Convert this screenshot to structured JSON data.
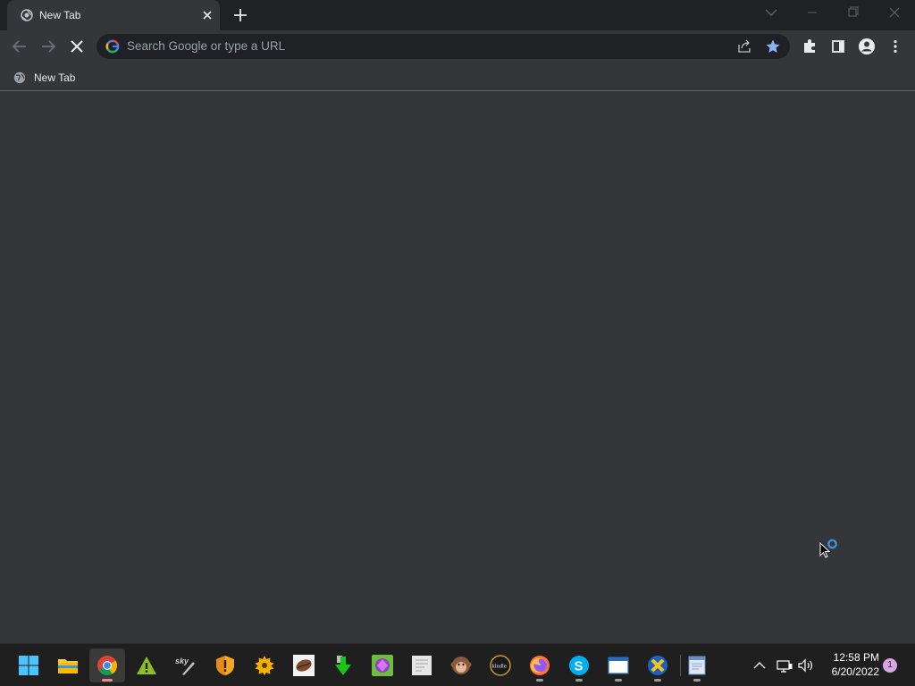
{
  "browser": {
    "tab": {
      "title": "New Tab"
    },
    "omnibox": {
      "placeholder": "Search Google or type a URL"
    },
    "bookmarks": [
      {
        "label": "New Tab"
      }
    ]
  },
  "taskbar": {
    "apps": [
      "start-windows-icon",
      "file-explorer-icon",
      "chrome-icon",
      "android-warning-icon",
      "sky-pen-icon",
      "shield-warning-icon",
      "sun-icon",
      "coffee-bean-icon",
      "download-arrow-icon",
      "gem-game-icon",
      "document-icon",
      "monkey-icon",
      "kindle-icon",
      "firefox-icon",
      "skype-icon",
      "window-icon",
      "x-app-icon",
      "notepad-icon"
    ],
    "clock": {
      "time": "12:58 PM",
      "date": "6/20/2022"
    },
    "notifications": {
      "count": "1"
    }
  },
  "colors": {
    "accent": "#8ab4f8",
    "tabstrip": "#202124",
    "toolbar": "#35363a",
    "taskbar": "#1f1f1f"
  }
}
